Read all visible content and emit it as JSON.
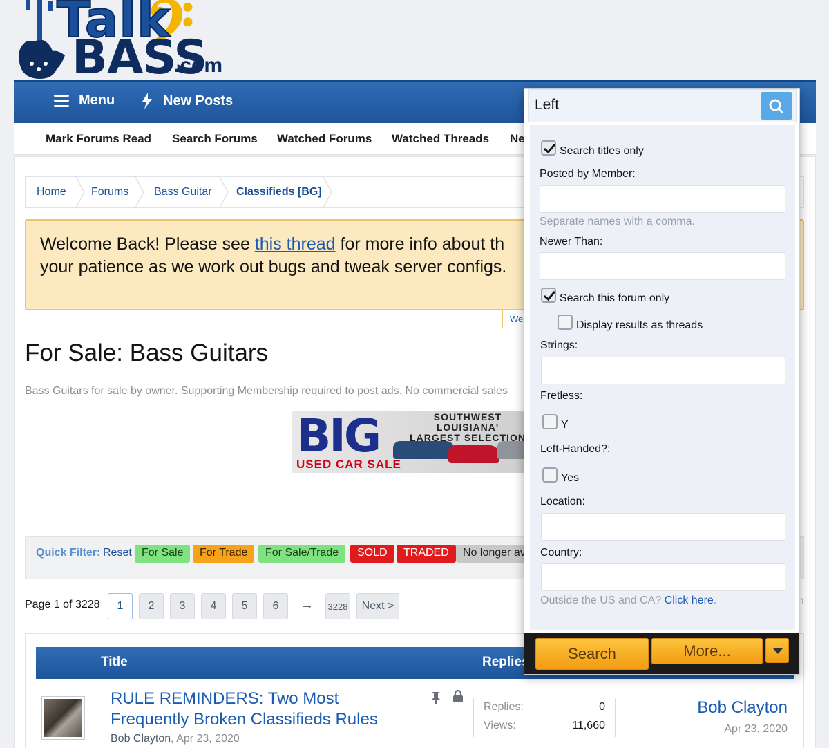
{
  "logo": {
    "talk": "Talk",
    "bass": "BASS",
    "com": ".com"
  },
  "nav": {
    "menu": "Menu",
    "new_posts": "New Posts"
  },
  "subnav": [
    "Mark Forums Read",
    "Search Forums",
    "Watched Forums",
    "Watched Threads",
    "Ne"
  ],
  "breadcrumb": [
    "Home",
    "Forums",
    "Bass Guitar",
    "Classifieds [BG]"
  ],
  "notice": {
    "line1_before": "Welcome Back!  Please see ",
    "link": "this thread",
    "line1_after": " for more info about th",
    "line2": "your patience as we work out bugs and tweak server configs.",
    "tab": "We"
  },
  "page": {
    "title": "For Sale: Bass Guitars",
    "description": "Bass Guitars for sale by owner. Supporting Membership required to post ads. No commercial sales"
  },
  "ad": {
    "big": "BIG",
    "used": "USED CAR SALE",
    "tagline1": "SOUTHWEST LOUISIANA'",
    "tagline2": "LARGEST SELECTION"
  },
  "filter": {
    "label": "Quick Filter:",
    "reset": "Reset",
    "chips": [
      {
        "label": "For Sale",
        "bg": "#7ee27e",
        "fg": "#1a3d1a"
      },
      {
        "label": "For Trade",
        "bg": "#f7a21b",
        "fg": "#3d2500"
      },
      {
        "label": "For Sale/Trade",
        "bg": "#7ee27e",
        "fg": "#1a3d1a"
      },
      {
        "label": "SOLD",
        "bg": "#e01b1b",
        "fg": "#ffffff"
      },
      {
        "label": "TRADED",
        "bg": "#e01b1b",
        "fg": "#ffffff"
      },
      {
        "label": "No longer av",
        "bg": "#c8c8c8",
        "fg": "#1f1f1f"
      }
    ]
  },
  "pager": {
    "label": "Page 1 of 3228",
    "pages": [
      "1",
      "2",
      "3",
      "4",
      "5",
      "6"
    ],
    "arrow": "→",
    "last": "3228",
    "next": "Next >"
  },
  "table": {
    "title_col": "Title",
    "replies_col": "Replies"
  },
  "thread": {
    "title": "RULE REMINDERS: Two Most Frequently Broken Classifieds Rules",
    "author": "Bob Clayton",
    "date": "Apr 23, 2020",
    "replies_label": "Replies:",
    "replies": "0",
    "views_label": "Views:",
    "views": "11,660",
    "last_user": "Bob Clayton",
    "last_date": "Apr 23, 2020"
  },
  "search": {
    "query": "Left",
    "titles_only": "Search titles only",
    "posted_by": "Posted by Member:",
    "posted_hint": "Separate names with a comma.",
    "newer_than": "Newer Than:",
    "forum_only": "Search this forum only",
    "as_threads": "Display results as threads",
    "strings": "Strings:",
    "fretless": "Fretless:",
    "fretless_y": "Y",
    "left_handed": "Left-Handed?:",
    "left_yes": "Yes",
    "location": "Location:",
    "country": "Country:",
    "outside_hint": "Outside the US and CA? ",
    "click_here": "Click here",
    "period": ".",
    "search_btn": "Search",
    "more_btn": "More..."
  },
  "edge_glyph": "n",
  "colors": {
    "nav_blue": "#1e559b",
    "accent_orange": "#f39c12",
    "link_blue": "#1b5cb3"
  }
}
